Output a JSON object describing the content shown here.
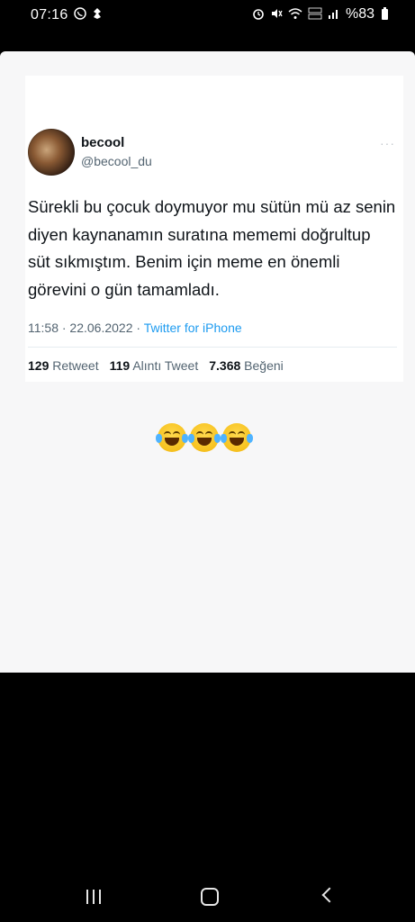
{
  "status_bar": {
    "time": "07:16",
    "icons_left": [
      "whatsapp-icon",
      "notification-icon"
    ],
    "icons_right": [
      "alarm-icon",
      "mute-icon",
      "wifi-icon",
      "volte-icon",
      "signal-icon",
      "battery-icon"
    ],
    "battery_text": "%83"
  },
  "tweet": {
    "display_name": "becool",
    "handle": "@becool_du",
    "more_label": "···",
    "text": "Sürekli bu çocuk doymuyor mu sütün mü az senin diyen kaynanamın suratına mememi doğrultup süt sıkmıştım. Benim için meme en önemli görevini o gün tamamladı.",
    "timestamp": "11:58 · 22.06.2022 ·",
    "source": "Twitter for iPhone",
    "stats": {
      "retweets_count": "129",
      "retweets_label": "Retweet",
      "quotes_count": "119",
      "quotes_label": "Alıntı Tweet",
      "likes_count": "7.368",
      "likes_label": "Beğeni"
    }
  },
  "emojis": [
    "face-with-tears-of-joy",
    "face-with-tears-of-joy",
    "face-with-tears-of-joy"
  ],
  "nav_bar": [
    "recent-apps-icon",
    "home-icon",
    "back-icon"
  ],
  "colors": {
    "link": "#1d9bf0",
    "sheet_bg": "#f7f7f8",
    "phone_bg": "#000000"
  }
}
